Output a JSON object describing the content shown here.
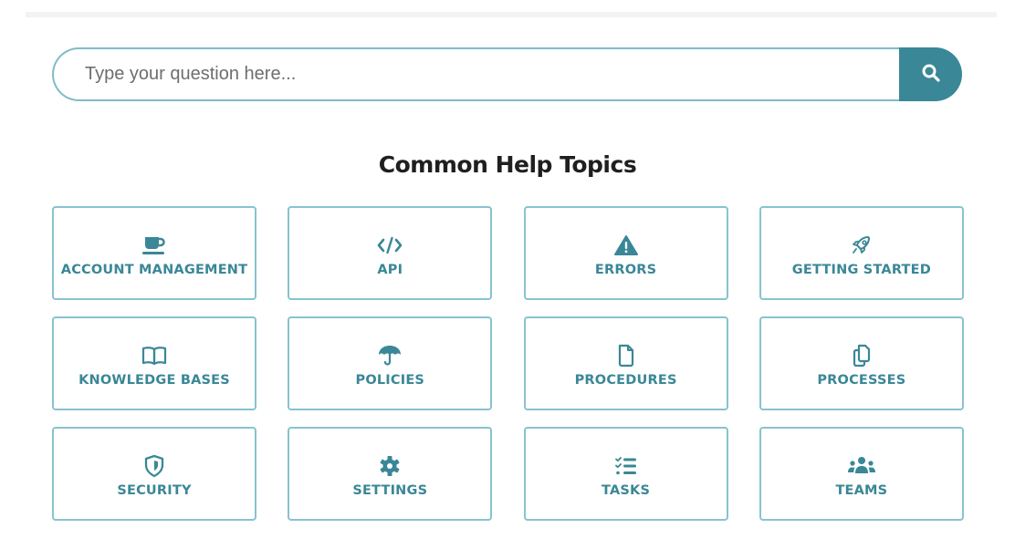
{
  "search": {
    "placeholder": "Type your question here...",
    "value": "",
    "button_icon": "search-icon"
  },
  "section": {
    "title": "Common Help Topics"
  },
  "colors": {
    "accent": "#3a8797",
    "card_border": "#87c3cf",
    "search_border": "#7fbcc8"
  },
  "topics": [
    {
      "label": "ACCOUNT MANAGEMENT",
      "icon": "coffee-cup-icon"
    },
    {
      "label": "API",
      "icon": "code-icon"
    },
    {
      "label": "ERRORS",
      "icon": "warning-triangle-icon"
    },
    {
      "label": "GETTING STARTED",
      "icon": "rocket-icon"
    },
    {
      "label": "KNOWLEDGE BASES",
      "icon": "book-open-icon"
    },
    {
      "label": "POLICIES",
      "icon": "umbrella-icon"
    },
    {
      "label": "PROCEDURES",
      "icon": "file-icon"
    },
    {
      "label": "PROCESSES",
      "icon": "copy-files-icon"
    },
    {
      "label": "SECURITY",
      "icon": "shield-icon"
    },
    {
      "label": "SETTINGS",
      "icon": "gear-icon"
    },
    {
      "label": "TASKS",
      "icon": "task-list-icon"
    },
    {
      "label": "TEAMS",
      "icon": "users-group-icon"
    }
  ]
}
